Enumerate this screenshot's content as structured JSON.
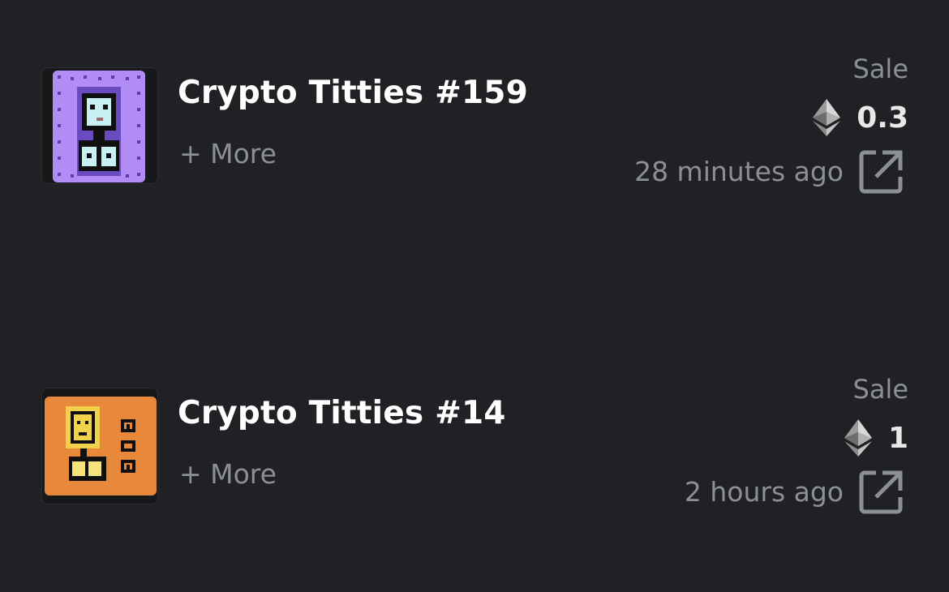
{
  "colors": {
    "background": "#202124",
    "title": "#ffffff",
    "muted": "#8c8f95",
    "price": "#e8e8e8",
    "thumb_bg_0": "#b28cf5",
    "thumb_bg_1": "#e8883a"
  },
  "activity": [
    {
      "thumbnail_icon": "nft-thumbnail-purple",
      "title": "Crypto Titties #159",
      "more_label": "+ More",
      "event": "Sale",
      "currency_icon": "ethereum-icon",
      "price": "0.3",
      "time": "28 minutes ago",
      "link_icon": "external-link-icon"
    },
    {
      "thumbnail_icon": "nft-thumbnail-orange",
      "title": "Crypto Titties #14",
      "more_label": "+ More",
      "event": "Sale",
      "currency_icon": "ethereum-icon",
      "price": "1",
      "time": "2 hours ago",
      "link_icon": "external-link-icon"
    }
  ]
}
